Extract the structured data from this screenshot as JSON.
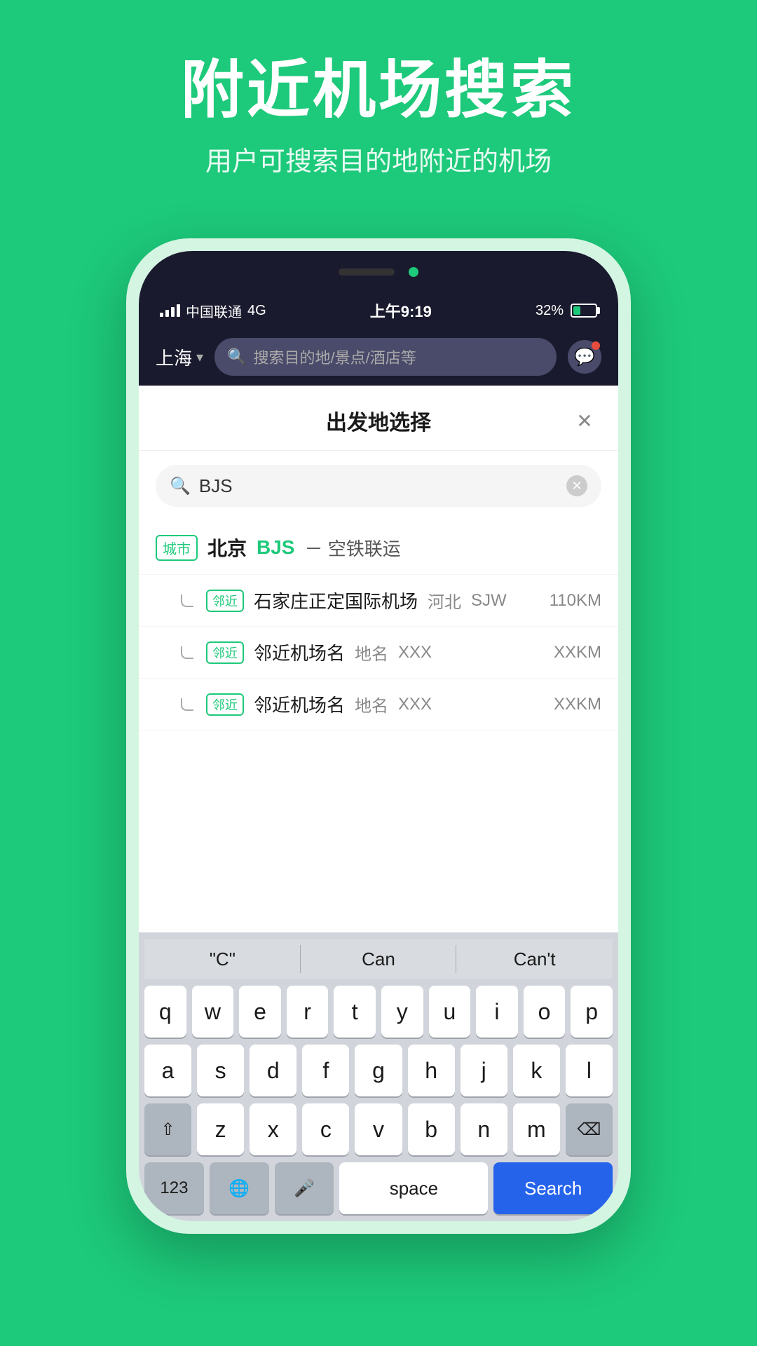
{
  "page": {
    "background_color": "#1DC97A",
    "title": "附近机场搜索",
    "subtitle": "用户可搜索目的地附近的机场"
  },
  "status_bar": {
    "carrier": "中国联通",
    "network": "4G",
    "time": "上午9:19",
    "battery_percent": "32%"
  },
  "app_topbar": {
    "city": "上海",
    "search_placeholder": "搜索目的地/景点/酒店等"
  },
  "modal": {
    "title": "出发地选择",
    "search_value": "BJS",
    "city_result": {
      "tag": "城市",
      "name": "北京",
      "code": "BJS",
      "suffix": "－ 空铁联运"
    },
    "nearby_airports": [
      {
        "tag": "邻近",
        "name": "石家庄正定国际机场",
        "region": "河北",
        "code": "SJW",
        "distance": "110KM"
      },
      {
        "tag": "邻近",
        "name": "邻近机场名",
        "region": "地名",
        "code": "XXX",
        "distance": "XXKM"
      },
      {
        "tag": "邻近",
        "name": "邻近机场名",
        "region": "地名",
        "code": "XXX",
        "distance": "XXKM"
      }
    ]
  },
  "keyboard": {
    "suggestions": [
      "\"C\"",
      "Can",
      "Can't"
    ],
    "row1": [
      "q",
      "w",
      "e",
      "r",
      "t",
      "y",
      "u",
      "i",
      "o",
      "p"
    ],
    "row2": [
      "a",
      "s",
      "d",
      "f",
      "g",
      "h",
      "j",
      "k",
      "l"
    ],
    "row3": [
      "z",
      "x",
      "c",
      "v",
      "b",
      "n",
      "m"
    ],
    "bottom": {
      "num": "123",
      "space": "space",
      "action": "Search"
    }
  }
}
